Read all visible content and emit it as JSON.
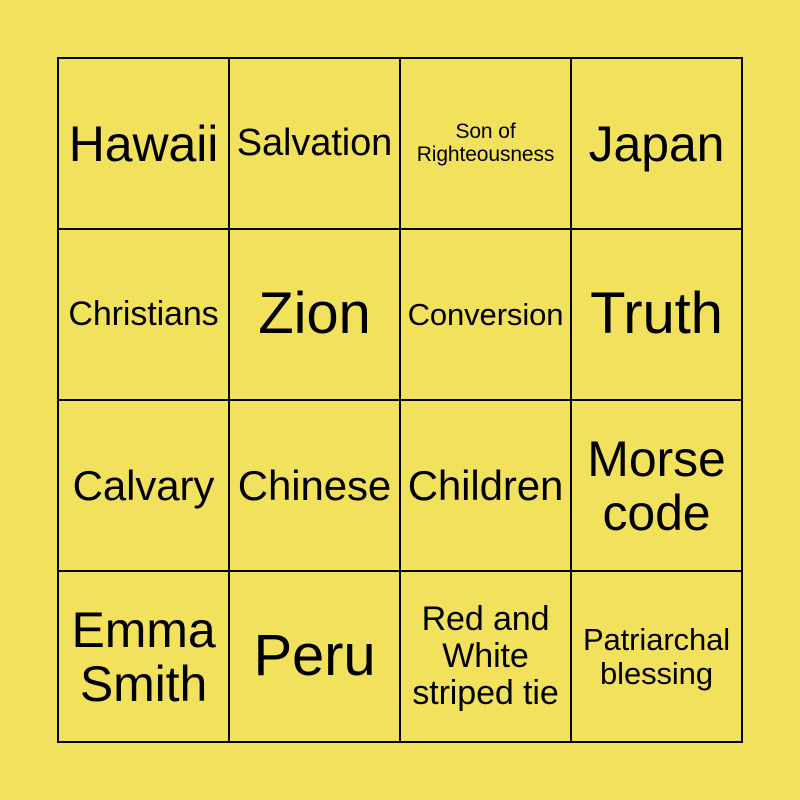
{
  "card": {
    "kind": "bingo-card",
    "columns": 4,
    "rows": 4,
    "background_color": "#f2e15c",
    "text_color": "#000000",
    "grid_line_color": "#000000",
    "cells": [
      {
        "text": "Hawaii",
        "size": "sz-xl"
      },
      {
        "text": "Salvation",
        "size": "sz-ml"
      },
      {
        "text": "Son of Righteousness",
        "size": "sz-xs"
      },
      {
        "text": "Japan",
        "size": "sz-xl"
      },
      {
        "text": "Christians",
        "size": "sz-m"
      },
      {
        "text": "Zion",
        "size": "sz-xxl"
      },
      {
        "text": "Conversion",
        "size": "sz-s"
      },
      {
        "text": "Truth",
        "size": "sz-xxl"
      },
      {
        "text": "Calvary",
        "size": "sz-l"
      },
      {
        "text": "Chinese",
        "size": "sz-l"
      },
      {
        "text": "Children",
        "size": "sz-l"
      },
      {
        "text": "Morse code",
        "size": "sz-xl"
      },
      {
        "text": "Emma Smith",
        "size": "sz-xl"
      },
      {
        "text": "Peru",
        "size": "sz-xxl"
      },
      {
        "text": "Red and White striped tie",
        "size": "sz-m"
      },
      {
        "text": "Patriarchal blessing",
        "size": "sz-s"
      }
    ]
  }
}
